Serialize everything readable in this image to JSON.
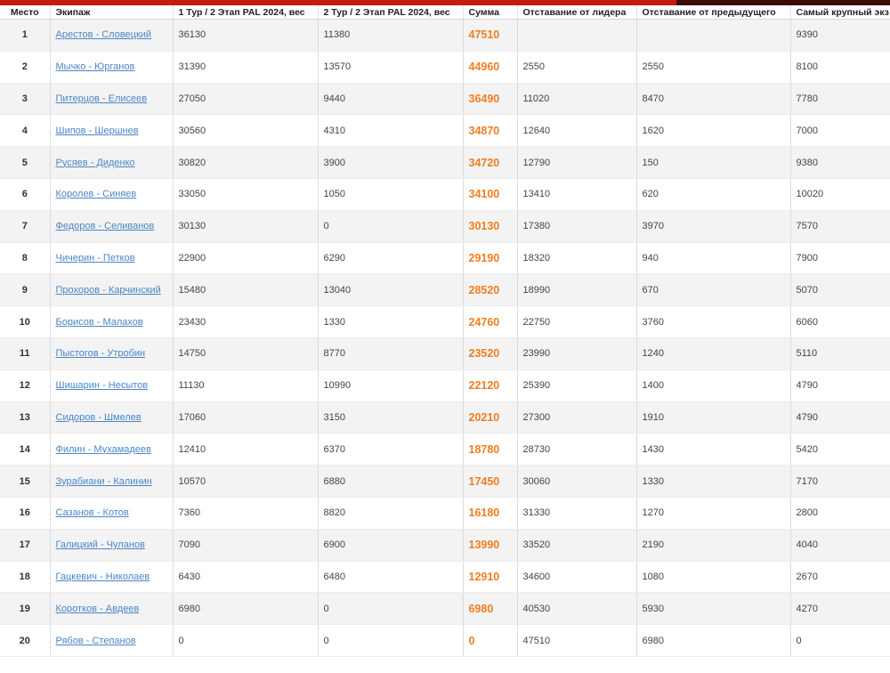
{
  "headers": [
    "Место",
    "Экипаж",
    "1 Тур / 2 Этап PAL 2024, вес",
    "2 Тур / 2 Этап PAL 2024, вес",
    "Сумма",
    "Отставание от лидера",
    "Отставание от предыдущего",
    "Самый крупный экз"
  ],
  "rows": [
    {
      "place": "1",
      "crew": "Арестов - Словецкий",
      "t1": "36130",
      "t2": "11380",
      "sum": "47510",
      "lag_leader": "",
      "lag_prev": "",
      "biggest": "9390"
    },
    {
      "place": "2",
      "crew": "Мычко - Юрганов",
      "t1": "31390",
      "t2": "13570",
      "sum": "44960",
      "lag_leader": "2550",
      "lag_prev": "2550",
      "biggest": "8100"
    },
    {
      "place": "3",
      "crew": "Питерцов - Елисеев",
      "t1": "27050",
      "t2": "9440",
      "sum": "36490",
      "lag_leader": "11020",
      "lag_prev": "8470",
      "biggest": "7780"
    },
    {
      "place": "4",
      "crew": "Шипов - Шершнев",
      "t1": "30560",
      "t2": "4310",
      "sum": "34870",
      "lag_leader": "12640",
      "lag_prev": "1620",
      "biggest": "7000"
    },
    {
      "place": "5",
      "crew": "Русяев - Диденко",
      "t1": "30820",
      "t2": "3900",
      "sum": "34720",
      "lag_leader": "12790",
      "lag_prev": "150",
      "biggest": "9380"
    },
    {
      "place": "6",
      "crew": "Королев - Синяев",
      "t1": "33050",
      "t2": "1050",
      "sum": "34100",
      "lag_leader": "13410",
      "lag_prev": "620",
      "biggest": "10020"
    },
    {
      "place": "7",
      "crew": "Федоров - Селиванов",
      "t1": "30130",
      "t2": "0",
      "sum": "30130",
      "lag_leader": "17380",
      "lag_prev": "3970",
      "biggest": "7570"
    },
    {
      "place": "8",
      "crew": "Чичерин - Петков",
      "t1": "22900",
      "t2": "6290",
      "sum": "29190",
      "lag_leader": "18320",
      "lag_prev": "940",
      "biggest": "7900"
    },
    {
      "place": "9",
      "crew": "Прохоров - Карчинский",
      "t1": "15480",
      "t2": "13040",
      "sum": "28520",
      "lag_leader": "18990",
      "lag_prev": "670",
      "biggest": "5070"
    },
    {
      "place": "10",
      "crew": "Борисов - Малахов",
      "t1": "23430",
      "t2": "1330",
      "sum": "24760",
      "lag_leader": "22750",
      "lag_prev": "3760",
      "biggest": "6060"
    },
    {
      "place": "11",
      "crew": "Пыстогов - Утробин",
      "t1": "14750",
      "t2": "8770",
      "sum": "23520",
      "lag_leader": "23990",
      "lag_prev": "1240",
      "biggest": "5110"
    },
    {
      "place": "12",
      "crew": "Шишарин - Несытов",
      "t1": "11130",
      "t2": "10990",
      "sum": "22120",
      "lag_leader": "25390",
      "lag_prev": "1400",
      "biggest": "4790"
    },
    {
      "place": "13",
      "crew": "Сидоров - Шмелев",
      "t1": "17060",
      "t2": "3150",
      "sum": "20210",
      "lag_leader": "27300",
      "lag_prev": "1910",
      "biggest": "4790"
    },
    {
      "place": "14",
      "crew": "Филин - Мухамадеев",
      "t1": "12410",
      "t2": "6370",
      "sum": "18780",
      "lag_leader": "28730",
      "lag_prev": "1430",
      "biggest": "5420"
    },
    {
      "place": "15",
      "crew": "Зурабиани - Калинин",
      "t1": "10570",
      "t2": "6880",
      "sum": "17450",
      "lag_leader": "30060",
      "lag_prev": "1330",
      "biggest": "7170"
    },
    {
      "place": "16",
      "crew": "Сазанов - Котов",
      "t1": "7360",
      "t2": "8820",
      "sum": "16180",
      "lag_leader": "31330",
      "lag_prev": "1270",
      "biggest": "2800"
    },
    {
      "place": "17",
      "crew": "Галицкий - Чуланов",
      "t1": "7090",
      "t2": "6900",
      "sum": "13990",
      "lag_leader": "33520",
      "lag_prev": "2190",
      "biggest": "4040"
    },
    {
      "place": "18",
      "crew": "Гацкевич - Николаев",
      "t1": "6430",
      "t2": "6480",
      "sum": "12910",
      "lag_leader": "34600",
      "lag_prev": "1080",
      "biggest": "2670"
    },
    {
      "place": "19",
      "crew": "Коротков - Авдеев",
      "t1": "6980",
      "t2": "0",
      "sum": "6980",
      "lag_leader": "40530",
      "lag_prev": "5930",
      "biggest": "4270"
    },
    {
      "place": "20",
      "crew": "Рябов - Степанов",
      "t1": "0",
      "t2": "0",
      "sum": "0",
      "lag_leader": "47510",
      "lag_prev": "6980",
      "biggest": "0"
    }
  ],
  "colors": {
    "accent_sum": "#f07d1f",
    "link": "#4a86c5",
    "topbar": "#c8190f"
  }
}
